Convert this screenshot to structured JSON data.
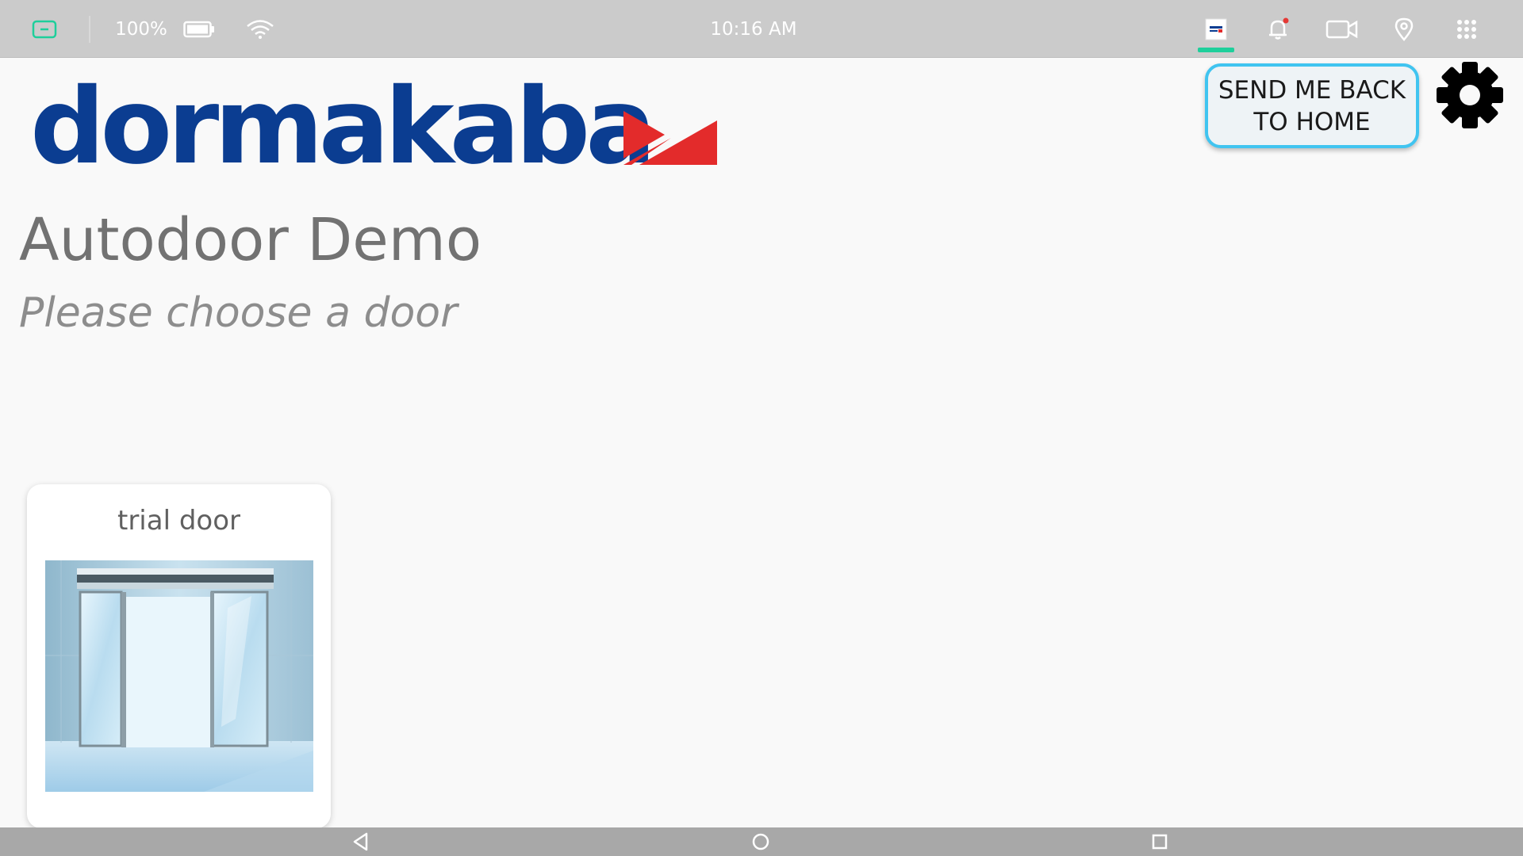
{
  "status_bar": {
    "battery_percent": "100%",
    "time": "10:16 AM",
    "icons": [
      "screen-badge-icon",
      "battery-icon",
      "wifi-icon",
      "app-thumbnail-icon",
      "bell-icon",
      "video-camera-icon",
      "location-pin-icon",
      "app-grid-icon"
    ],
    "accent_color": "#1ecf9b",
    "notification_dot_color": "#e53935"
  },
  "logo": {
    "wordmark": "dormakaba",
    "color": "#0b3d91",
    "mark_color": "#e32b2b"
  },
  "header": {
    "home_button_label": "SEND ME BACK\nTO HOME",
    "settings_icon": "gear-icon"
  },
  "main": {
    "title": "Autodoor Demo",
    "subtitle": "Please choose a door",
    "doors": [
      {
        "name": "trial door",
        "image": "automatic-sliding-door"
      }
    ]
  },
  "nav_bar": {
    "buttons": [
      "back-icon",
      "home-icon",
      "recent-apps-icon"
    ]
  }
}
